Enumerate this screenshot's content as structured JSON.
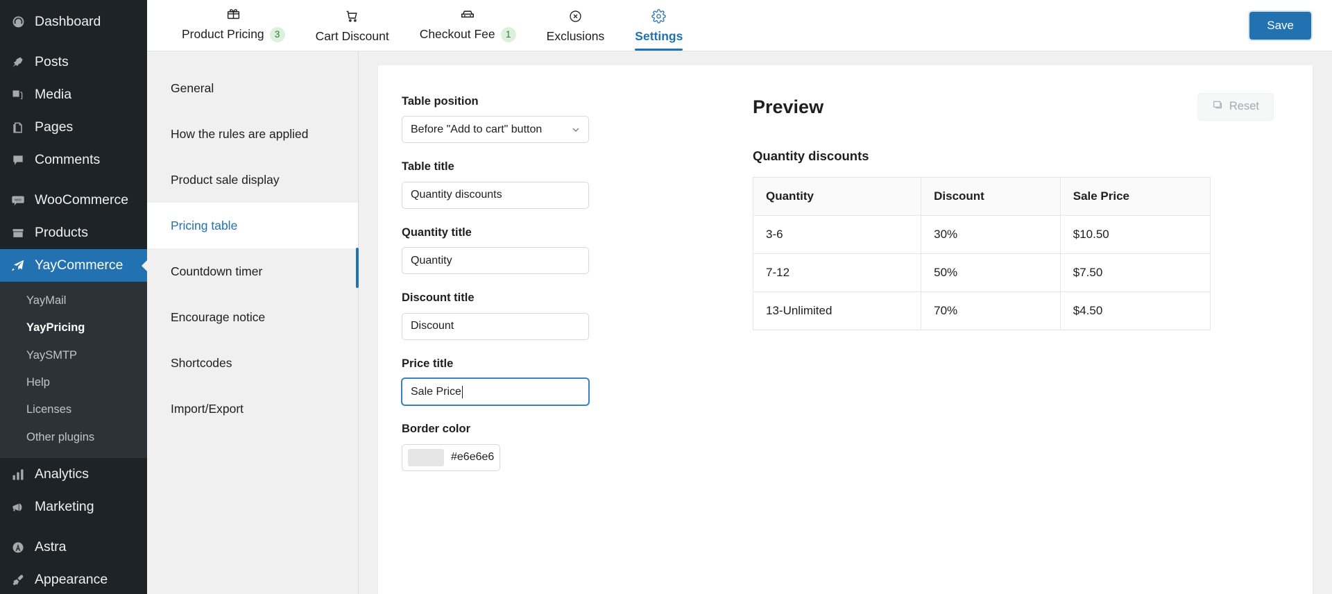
{
  "wp_sidebar": {
    "items": [
      {
        "label": "Dashboard",
        "icon": "dashboard-icon",
        "gap_after": true
      },
      {
        "label": "Posts",
        "icon": "pin-icon",
        "gap_after": false
      },
      {
        "label": "Media",
        "icon": "media-icon",
        "gap_after": false
      },
      {
        "label": "Pages",
        "icon": "pages-icon",
        "gap_after": false
      },
      {
        "label": "Comments",
        "icon": "comments-icon",
        "gap_after": true
      },
      {
        "label": "WooCommerce",
        "icon": "woo-icon",
        "gap_after": false
      },
      {
        "label": "Products",
        "icon": "products-icon",
        "gap_after": false
      }
    ],
    "active_item": {
      "label": "YayCommerce",
      "icon": "yaycommerce-icon"
    },
    "submenu": [
      {
        "label": "YayMail",
        "current": false
      },
      {
        "label": "YayPricing",
        "current": true
      },
      {
        "label": "YaySMTP",
        "current": false
      },
      {
        "label": "Help",
        "current": false
      },
      {
        "label": "Licenses",
        "current": false
      },
      {
        "label": "Other plugins",
        "current": false
      }
    ],
    "items_after": [
      {
        "label": "Analytics",
        "icon": "analytics-icon",
        "gap_after": false
      },
      {
        "label": "Marketing",
        "icon": "megaphone-icon",
        "gap_after": true
      },
      {
        "label": "Astra",
        "icon": "astra-icon",
        "gap_after": false
      },
      {
        "label": "Appearance",
        "icon": "brush-icon",
        "gap_after": false
      }
    ]
  },
  "topbar": {
    "tabs": [
      {
        "label": "Product Pricing",
        "icon": "gift-icon",
        "badge": "3",
        "active": false
      },
      {
        "label": "Cart Discount",
        "icon": "cart-icon",
        "badge": "",
        "active": false
      },
      {
        "label": "Checkout Fee",
        "icon": "checkout-icon",
        "badge": "1",
        "active": false
      },
      {
        "label": "Exclusions",
        "icon": "circle-x-icon",
        "badge": "",
        "active": false
      },
      {
        "label": "Settings",
        "icon": "gear-icon",
        "badge": "",
        "active": true
      }
    ],
    "save_label": "Save"
  },
  "settings_nav": {
    "items": [
      {
        "label": "General",
        "active": false
      },
      {
        "label": "How the rules are applied",
        "active": false
      },
      {
        "label": "Product sale display",
        "active": false
      },
      {
        "label": "Pricing table",
        "active": true
      },
      {
        "label": "Countdown timer",
        "active": false
      },
      {
        "label": "Encourage notice",
        "active": false
      },
      {
        "label": "Shortcodes",
        "active": false
      },
      {
        "label": "Import/Export",
        "active": false
      }
    ]
  },
  "form": {
    "table_position": {
      "label": "Table position",
      "value": "Before \"Add to cart\" button"
    },
    "table_title": {
      "label": "Table title",
      "value": "Quantity discounts"
    },
    "quantity_title": {
      "label": "Quantity title",
      "value": "Quantity"
    },
    "discount_title": {
      "label": "Discount title",
      "value": "Discount"
    },
    "price_title": {
      "label": "Price title",
      "value": "Sale Price"
    },
    "border_color": {
      "label": "Border color",
      "value": "#e6e6e6",
      "swatch": "#e6e6e6"
    }
  },
  "preview": {
    "title": "Preview",
    "reset_label": "Reset",
    "table_title": "Quantity discounts",
    "columns": [
      "Quantity",
      "Discount",
      "Sale Price"
    ],
    "rows": [
      [
        "3-6",
        "30%",
        "$10.50"
      ],
      [
        "7-12",
        "50%",
        "$7.50"
      ],
      [
        "13-Unlimited",
        "70%",
        "$4.50"
      ]
    ]
  },
  "colors": {
    "wp_sidebar_bg": "#1d2327",
    "wp_submenu_bg": "#2c3338",
    "accent_blue": "#2271b1",
    "badge_bg": "#dcf0dc",
    "badge_text": "#2f7a3a",
    "table_border": "#e6e6e6"
  }
}
